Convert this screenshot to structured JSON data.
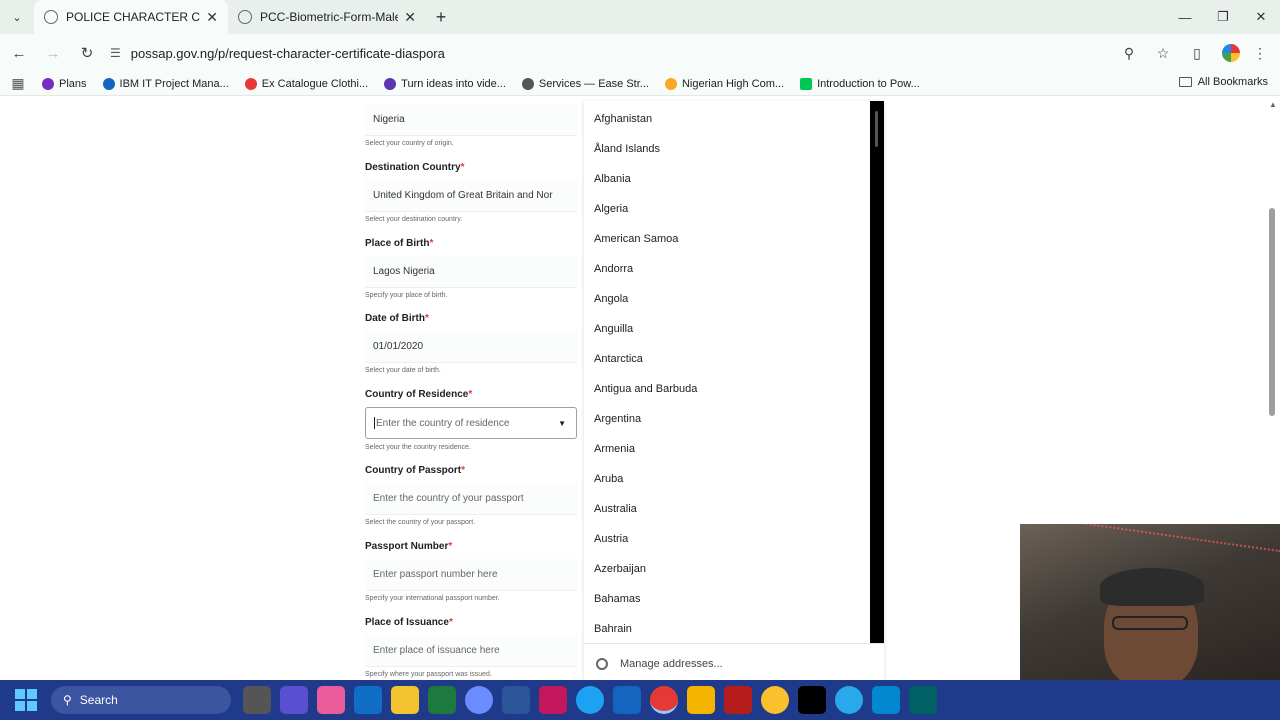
{
  "browser": {
    "tabs": [
      {
        "title": "POLICE CHARACTER CERTIFICA",
        "active": true
      },
      {
        "title": "PCC-Biometric-Form-Male.pdf",
        "active": false
      }
    ],
    "url": "possap.gov.ng/p/request-character-certificate-diaspora",
    "bookmarks": [
      {
        "label": "Plans",
        "color": "#7b2cbf"
      },
      {
        "label": "IBM IT Project Mana...",
        "color": "#1565c0"
      },
      {
        "label": "Ex Catalogue Clothi...",
        "color": "#e53935"
      },
      {
        "label": "Turn ideas into vide...",
        "color": "#5e35b1"
      },
      {
        "label": "Services — Ease Str...",
        "color": "#555555"
      },
      {
        "label": "Nigerian High Com...",
        "color": "#f9a825"
      },
      {
        "label": "Introduction to Pow...",
        "color": "#00c853"
      }
    ],
    "all_bookmarks": "All Bookmarks"
  },
  "form": {
    "origin": {
      "value": "Nigeria",
      "help": "Select your country of origin."
    },
    "destination": {
      "label": "Destination Country",
      "value": "United Kingdom of Great Britain and Nor",
      "help": "Select your destination country."
    },
    "place_of_birth": {
      "label": "Place of Birth",
      "value": "Lagos Nigeria",
      "help": "Specify your place of birth."
    },
    "date_of_birth": {
      "label": "Date of Birth",
      "value": "01/01/2020",
      "help": "Select your date of birth."
    },
    "residence": {
      "label": "Country of Residence",
      "placeholder": "Enter the country of residence",
      "help": "Select your the country residence."
    },
    "passport_country": {
      "label": "Country of Passport",
      "placeholder": "Enter the country of your passport",
      "help": "Select the country of your passport."
    },
    "passport_number": {
      "label": "Passport Number",
      "placeholder": "Enter passport number here",
      "help": "Specify your international passport number."
    },
    "place_of_issuance": {
      "label": "Place of Issuance",
      "placeholder": "Enter place of issuance here",
      "help": "Specify where your passport was issued."
    },
    "required_mark": "*"
  },
  "dropdown": {
    "options": [
      "Afghanistan",
      "Åland Islands",
      "Albania",
      "Algeria",
      "American Samoa",
      "Andorra",
      "Angola",
      "Anguilla",
      "Antarctica",
      "Antigua and Barbuda",
      "Argentina",
      "Armenia",
      "Aruba",
      "Australia",
      "Austria",
      "Azerbaijan",
      "Bahamas",
      "Bahrain"
    ],
    "footer": "Manage addresses..."
  },
  "taskbar": {
    "search": "Search"
  }
}
